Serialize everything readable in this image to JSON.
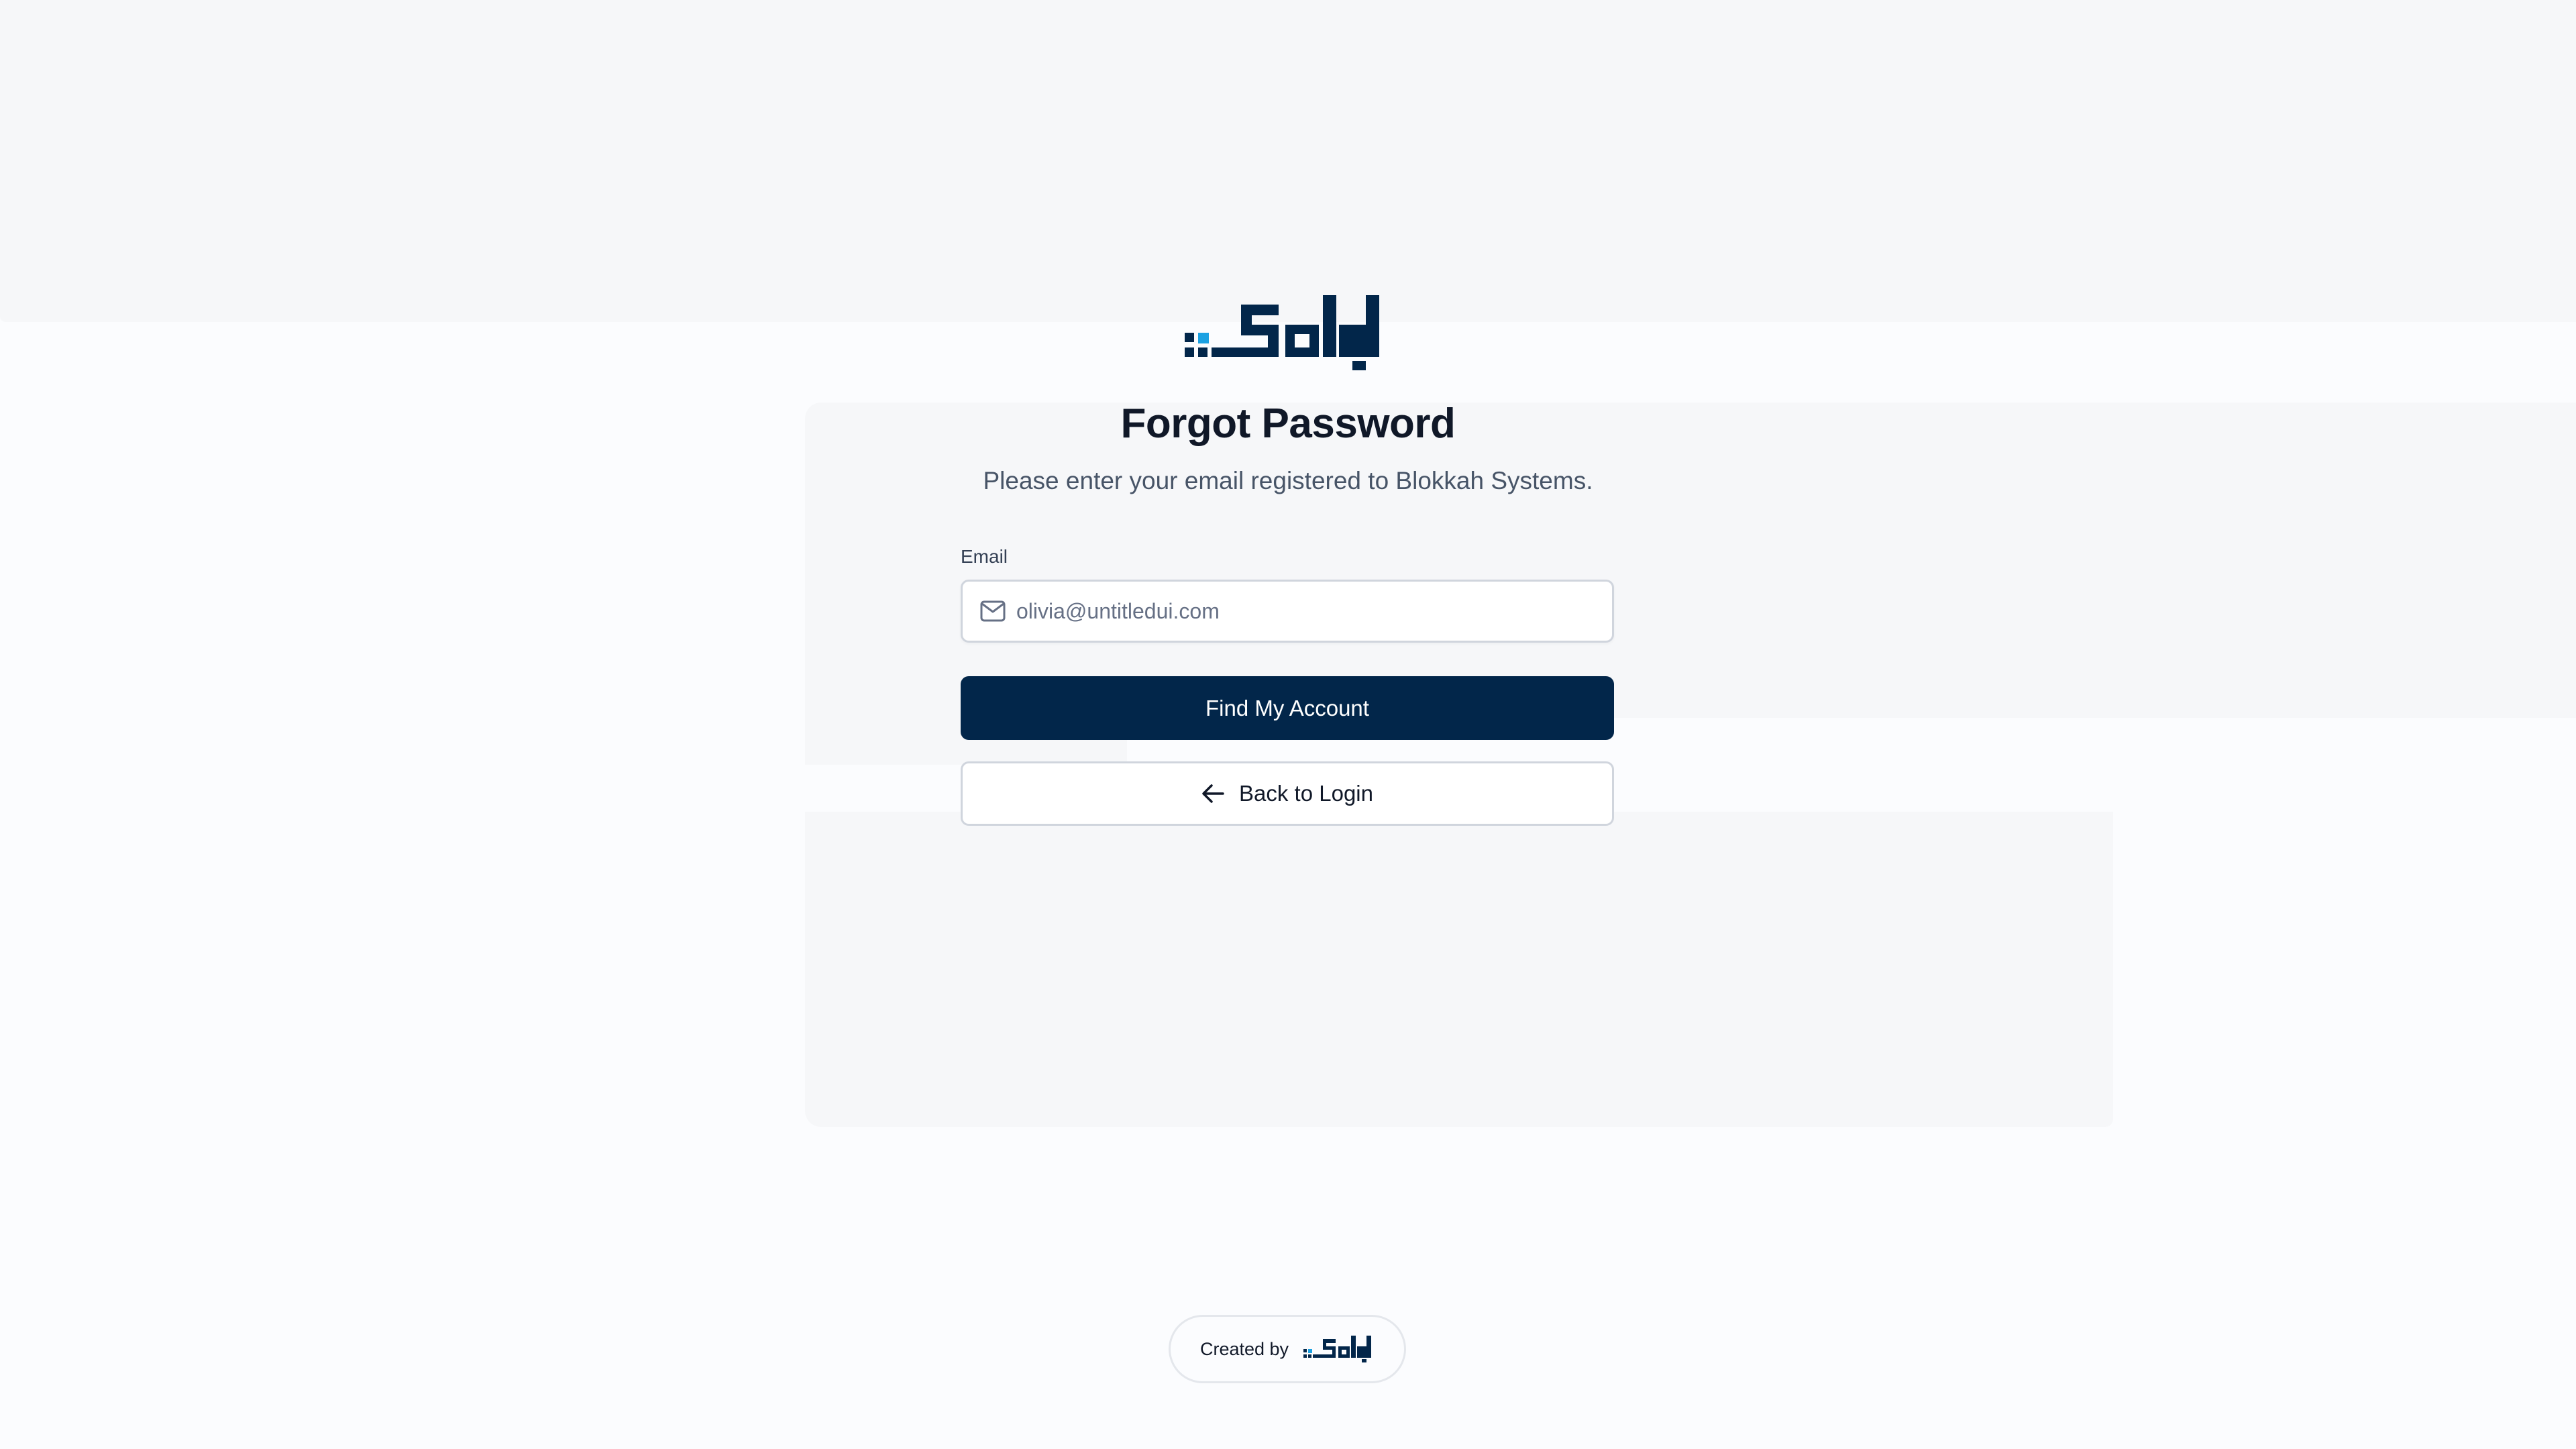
{
  "brand": {
    "logo_icon": "blokkah-logo",
    "primary_color": "#02264a",
    "accent_color": "#1ba1e2"
  },
  "header": {
    "title": "Forgot Password",
    "subtitle": "Please enter your email registered to Blokkah Systems."
  },
  "form": {
    "email_label": "Email",
    "email_placeholder": "olivia@untitledui.com",
    "email_value": "",
    "email_icon": "mail-icon"
  },
  "actions": {
    "find_account_label": "Find My Account",
    "back_to_login_label": "Back to Login",
    "back_icon": "arrow-left-icon"
  },
  "footer": {
    "created_by_label": "Created by",
    "logo_icon": "blokkah-logo"
  }
}
